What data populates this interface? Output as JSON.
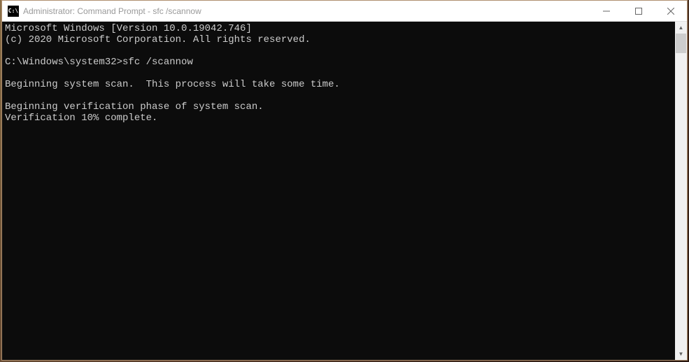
{
  "window": {
    "title": "Administrator: Command Prompt - sfc  /scannow",
    "icon_label": "C:\\"
  },
  "controls": {
    "minimize": "—",
    "maximize": "□",
    "close": "✕"
  },
  "console": {
    "lines": [
      "Microsoft Windows [Version 10.0.19042.746]",
      "(c) 2020 Microsoft Corporation. All rights reserved.",
      "",
      "C:\\Windows\\system32>sfc /scannow",
      "",
      "Beginning system scan.  This process will take some time.",
      "",
      "Beginning verification phase of system scan.",
      "Verification 10% complete."
    ]
  },
  "scrollbar": {
    "up": "▲",
    "down": "▼"
  }
}
